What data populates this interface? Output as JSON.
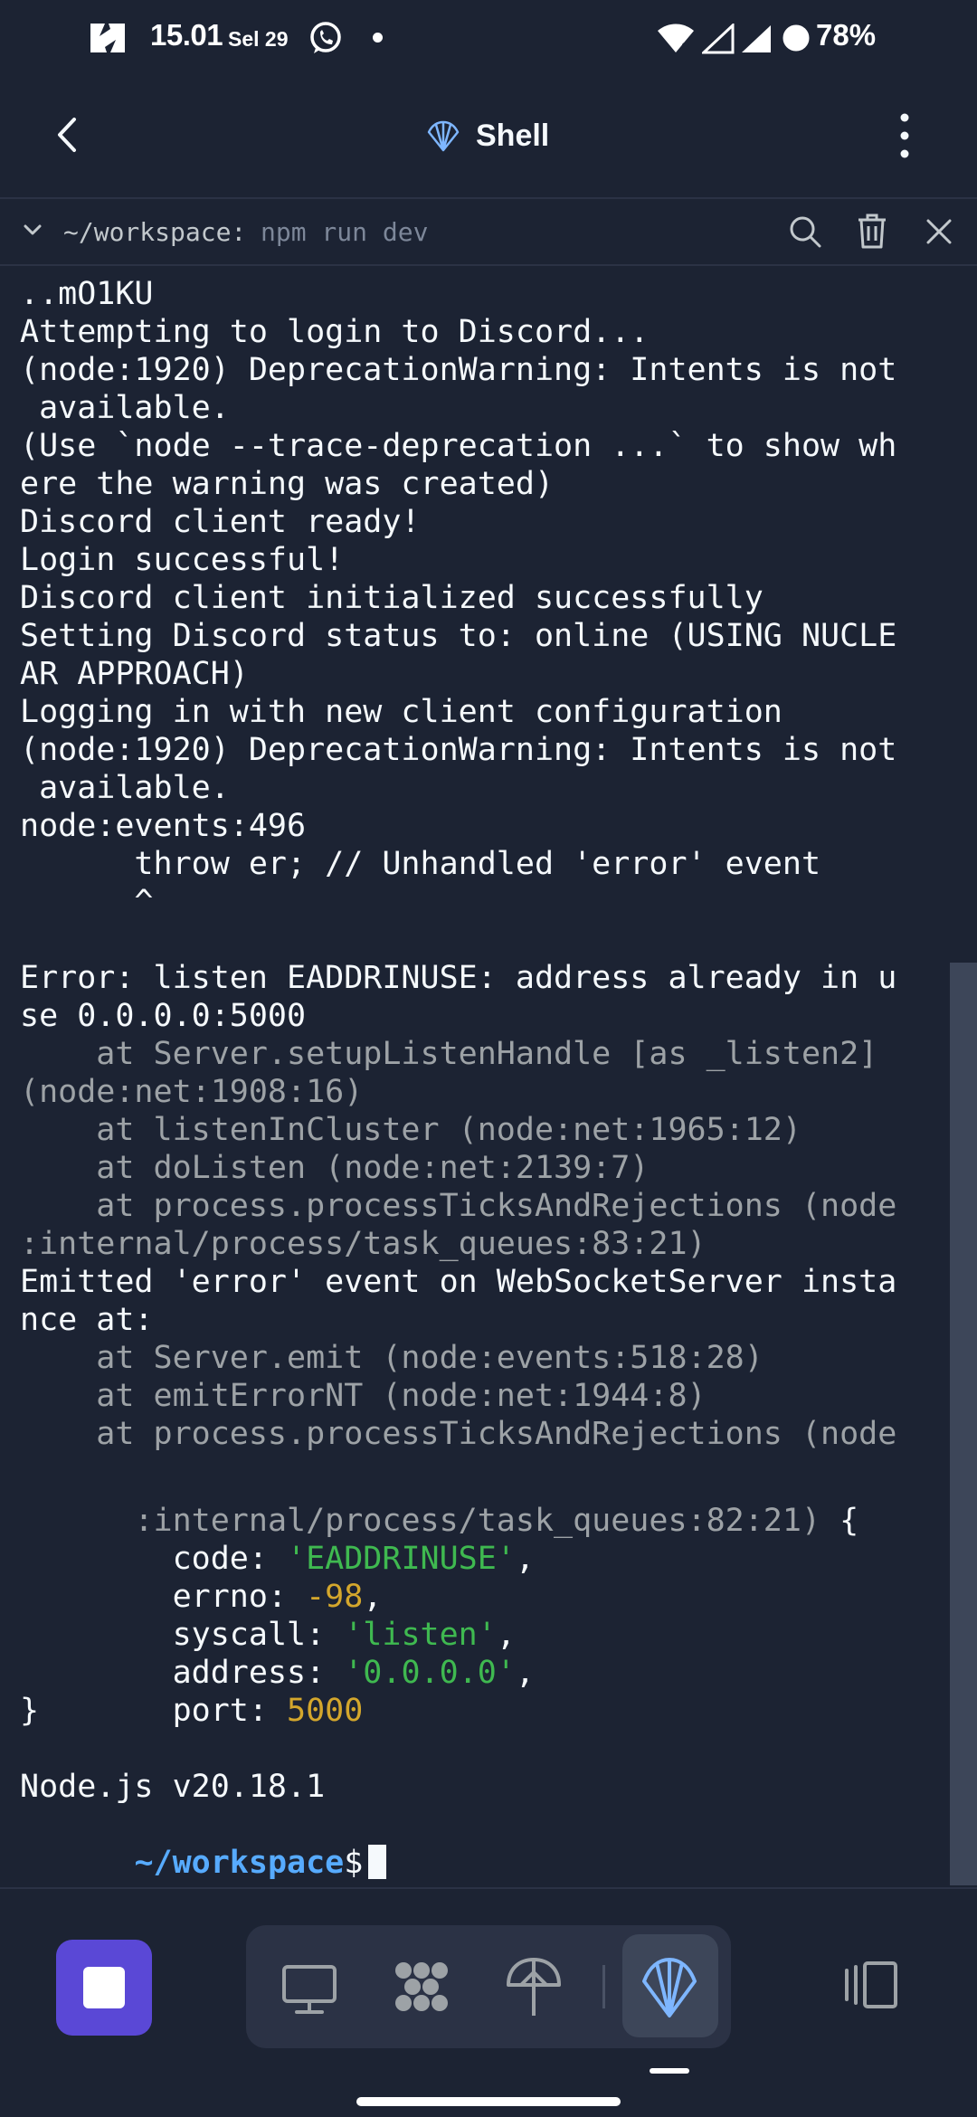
{
  "status_bar": {
    "time": "15.01",
    "date": "Sel 29",
    "battery": "78%",
    "icons": [
      "app-notification-icon",
      "whatsapp-icon",
      "wifi-icon",
      "signal-icon",
      "signal-icon",
      "battery-icon"
    ]
  },
  "header": {
    "title": "Shell",
    "icons": {
      "back": "back-arrow-icon",
      "title": "shell-icon",
      "menu": "more-vert-icon"
    }
  },
  "tab": {
    "cwd": "~/workspace:",
    "command": "npm run dev",
    "icons": {
      "collapse": "chevron-down-icon",
      "search": "search-icon",
      "clear": "trash-icon",
      "close": "close-icon"
    }
  },
  "terminal": {
    "lines": [
      "..mO1KU",
      "Attempting to login to Discord...",
      "(node:1920) DeprecationWarning: Intents is not",
      " available.",
      "(Use `node --trace-deprecation ...` to show wh",
      "ere the warning was created)",
      "Discord client ready!",
      "Login successful!",
      "Discord client initialized successfully",
      "Setting Discord status to: online (USING NUCLE",
      "AR APPROACH)",
      "Logging in with new client configuration",
      "(node:1920) DeprecationWarning: Intents is not",
      " available.",
      "node:events:496",
      "      throw er; // Unhandled 'error' event",
      "      ^",
      "",
      "Error: listen EADDRINUSE: address already in u",
      "se 0.0.0.0:5000",
      "    at Server.setupListenHandle [as _listen2]",
      "(node:net:1908:16)",
      "    at listenInCluster (node:net:1965:12)",
      "    at doListen (node:net:2139:7)",
      "    at process.processTicksAndRejections (node",
      ":internal/process/task_queues:83:21)",
      "Emitted 'error' event on WebSocketServer insta",
      "nce at:",
      "    at Server.emit (node:events:518:28)",
      "    at emitErrorNT (node:net:1944:8)",
      "    at process.processTicksAndRejections (node",
      ":internal/process/task_queues:82:21)"
    ],
    "brace_open": " {",
    "fields": [
      {
        "key": "  code: ",
        "value": "'EADDRINUSE'",
        "kind": "str",
        "suffix": ","
      },
      {
        "key": "  errno: ",
        "value": "-98",
        "kind": "num",
        "suffix": ","
      },
      {
        "key": "  syscall: ",
        "value": "'listen'",
        "kind": "str",
        "suffix": ","
      },
      {
        "key": "  address: ",
        "value": "'0.0.0.0'",
        "kind": "str",
        "suffix": ","
      },
      {
        "key": "  port: ",
        "value": "5000",
        "kind": "num",
        "suffix": ""
      }
    ],
    "brace_close": "}",
    "node_version": "Node.js v20.18.1",
    "prompt_path": "~/workspace",
    "prompt_symbol": "$"
  },
  "bottom_nav": {
    "icons": [
      "stop-icon",
      "monitor-icon",
      "extensions-icon",
      "deploy-icon",
      "shell-icon",
      "panels-icon"
    ],
    "active": "shell-icon",
    "colors": {
      "stop_button": "#5a48d6",
      "active_tab": "#3d4659"
    }
  },
  "colors": {
    "background": "#1c2333",
    "text": "#f5f9fc",
    "dim": "#9da2a6",
    "string": "#3fb950",
    "number": "#d4a72c",
    "prompt": "#57abff"
  }
}
